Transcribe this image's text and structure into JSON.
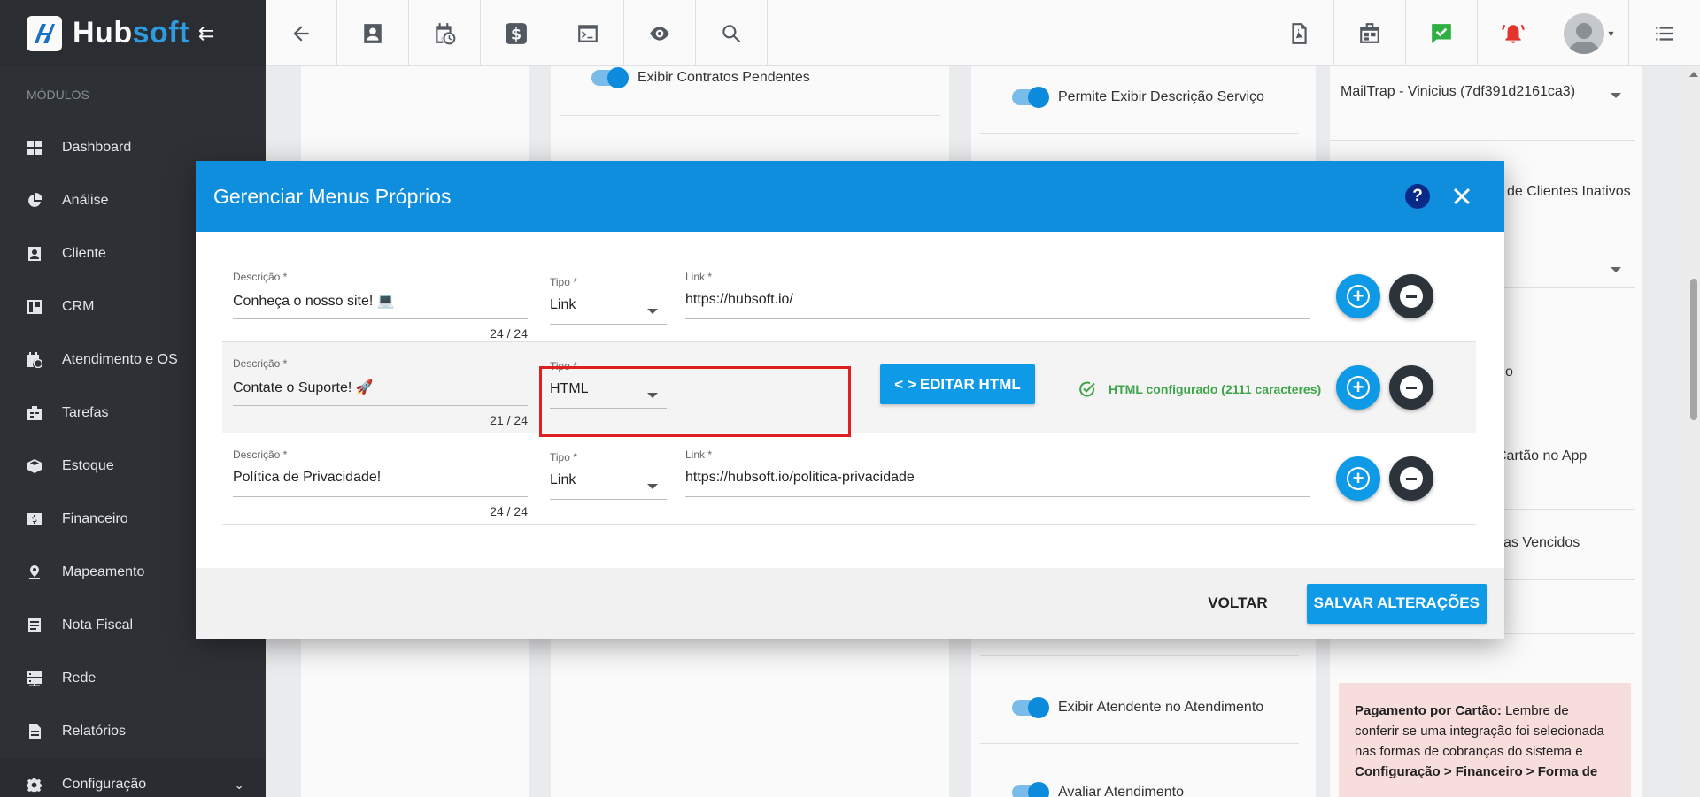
{
  "brand": {
    "name_part1": "Hub",
    "name_part2": "soft",
    "accent": "#0f8ede"
  },
  "sidebar": {
    "section_label": "MÓDULOS",
    "items": [
      {
        "label": "Dashboard",
        "icon": "dashboard-icon"
      },
      {
        "label": "Análise",
        "icon": "pie-chart-icon"
      },
      {
        "label": "Cliente",
        "icon": "contact-card-icon"
      },
      {
        "label": "CRM",
        "icon": "crm-board-icon"
      },
      {
        "label": "Atendimento e OS",
        "icon": "calendar-clock-icon"
      },
      {
        "label": "Tarefas",
        "icon": "tasks-icon"
      },
      {
        "label": "Estoque",
        "icon": "box-icon"
      },
      {
        "label": "Financeiro",
        "icon": "money-icon"
      },
      {
        "label": "Mapeamento",
        "icon": "map-pin-icon"
      },
      {
        "label": "Nota Fiscal",
        "icon": "invoice-icon"
      },
      {
        "label": "Rede",
        "icon": "server-icon"
      },
      {
        "label": "Relatórios",
        "icon": "report-icon"
      },
      {
        "label": "Configuração",
        "icon": "gear-icon"
      }
    ]
  },
  "background": {
    "col1_toggle": "Exibir Contratos Pendentes",
    "col2_toggle": "Permite Exibir Descrição Serviço",
    "col2_toggle_bottom": "Exibir Atendente no Atendimento",
    "col2_toggle_cut": "Avaliar Atendimento",
    "col3_select": "MailTrap - Vinicius (7df391d2161ca3)",
    "col3_text1": "de Clientes Inativos",
    "col3_text2": "o",
    "col3_text3": "Cartão no App",
    "col3_text4": "as Vencidos",
    "alert_bold1": "Pagamento por Cartão:",
    "alert_text1": " Lembre de conferir se uma integração foi selecionada nas formas de cobranças do sistema e",
    "alert_bold2": "Configuração > Financeiro > Forma de"
  },
  "modal": {
    "title": "Gerenciar Menus Próprios",
    "rows": [
      {
        "desc_label": "Descrição *",
        "desc_value": "Conheça o nosso site! 💻",
        "counter": "24 / 24",
        "tipo_label": "Tipo *",
        "tipo_value": "Link",
        "link_label": "Link *",
        "link_value": "https://hubsoft.io/"
      },
      {
        "desc_label": "Descrição *",
        "desc_value": "Contate o Suporte! 🚀",
        "counter": "21 / 24",
        "tipo_label": "Tipo *",
        "tipo_value": "HTML",
        "edit_button": "EDITAR HTML",
        "status": "HTML configurado (2111 caracteres)"
      },
      {
        "desc_label": "Descrição *",
        "desc_value": "Política de Privacidade!",
        "counter": "24 / 24",
        "tipo_label": "Tipo *",
        "tipo_value": "Link",
        "link_label": "Link *",
        "link_value": "https://hubsoft.io/politica-privacidade"
      }
    ],
    "footer": {
      "back": "VOLTAR",
      "save": "SALVAR ALTERAÇÕES"
    }
  }
}
